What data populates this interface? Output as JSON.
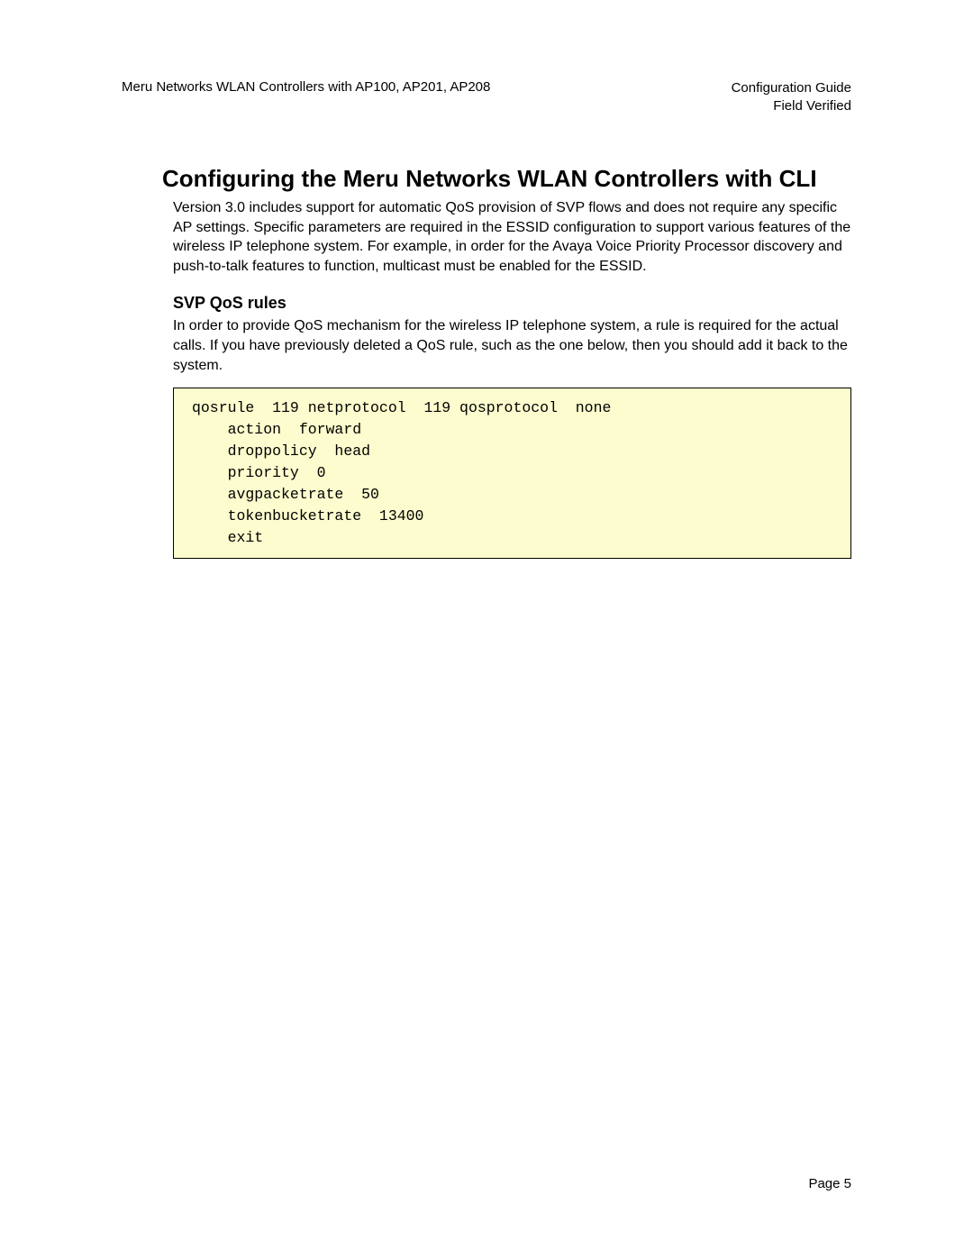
{
  "header": {
    "left": "Meru Networks WLAN Controllers with AP100, AP201, AP208",
    "right_line1": "Configuration Guide",
    "right_line2": "Field Verified"
  },
  "main": {
    "heading": "Configuring the Meru Networks WLAN Controllers with CLI",
    "intro": "Version 3.0 includes support for automatic QoS provision of SVP flows and does not require any specific AP settings. Specific parameters are required in the ESSID configuration to support various features of the wireless IP telephone system. For example, in order for the Avaya Voice Priority Processor discovery and push-to-talk features to function, multicast must be enabled for the ESSID.",
    "sub_heading": "SVP QoS rules",
    "sub_paragraph": "In order to provide QoS mechanism for the wireless IP telephone system, a rule is required for the actual calls. If you have previously deleted a QoS rule, such as the one below, then you should add it back to the system.",
    "code": "qosrule  119 netprotocol  119 qosprotocol  none\n    action  forward\n    droppolicy  head\n    priority  0\n    avgpacketrate  50\n    tokenbucketrate  13400\n    exit"
  },
  "footer": {
    "page_label": "Page 5"
  }
}
